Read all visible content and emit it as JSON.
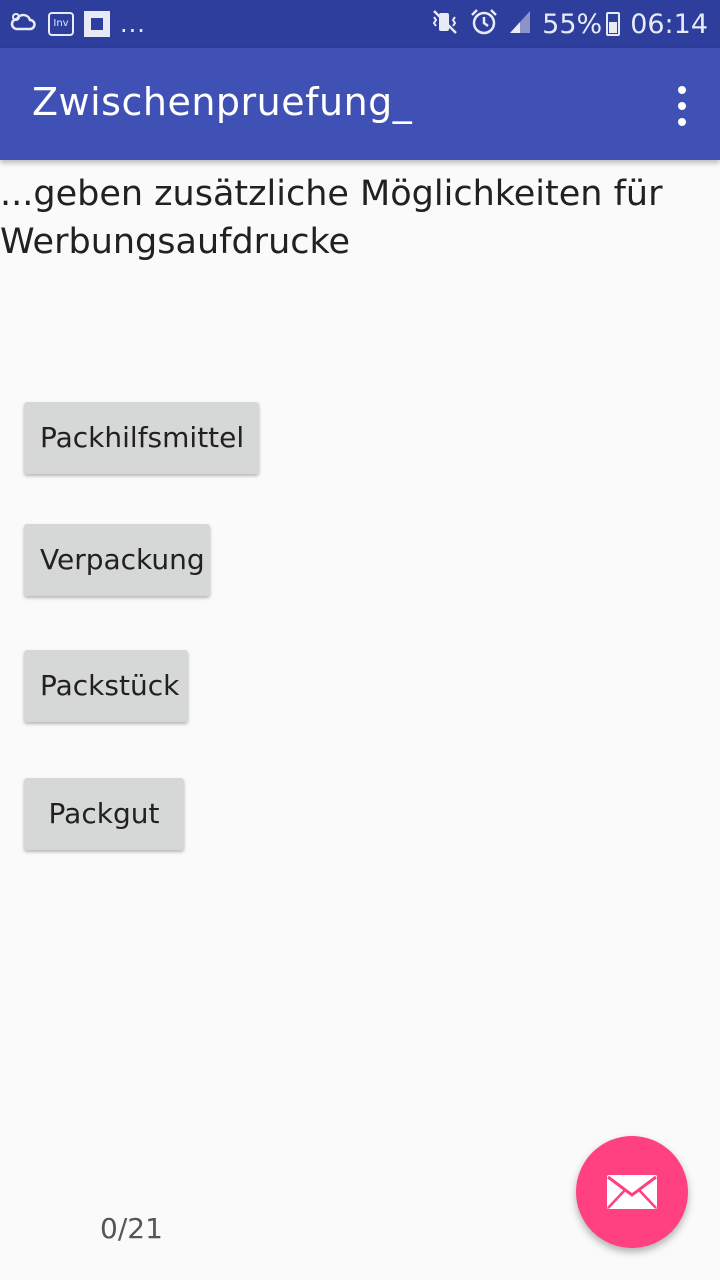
{
  "status_bar": {
    "notification_icons": [
      "weather-icon",
      "inv-icon",
      "flipboard-icon"
    ],
    "inv_label": "Inv",
    "more_indicator": "...",
    "status_icons": [
      "mute-vibrate-icon",
      "alarm-icon",
      "signal-icon",
      "battery-icon"
    ],
    "battery_percent": "55%",
    "time": "06:14"
  },
  "app_bar": {
    "title": "Zwischenpruefung_",
    "menu_icon": "overflow-menu-icon"
  },
  "question": {
    "text": "...geben zusätzliche Möglichkeiten für Werbungsaufdrucke"
  },
  "answers": [
    {
      "label": "Packhilfsmittel"
    },
    {
      "label": "Verpackung"
    },
    {
      "label": "Packstück"
    },
    {
      "label": "Packgut"
    }
  ],
  "progress": {
    "text": "0/21"
  },
  "fab": {
    "icon": "mail-icon"
  },
  "colors": {
    "status_bar": "#2d3e9d",
    "app_bar": "#3f51b5",
    "fab": "#ff4081",
    "button": "#d6d7d7",
    "background": "#fafafa"
  }
}
